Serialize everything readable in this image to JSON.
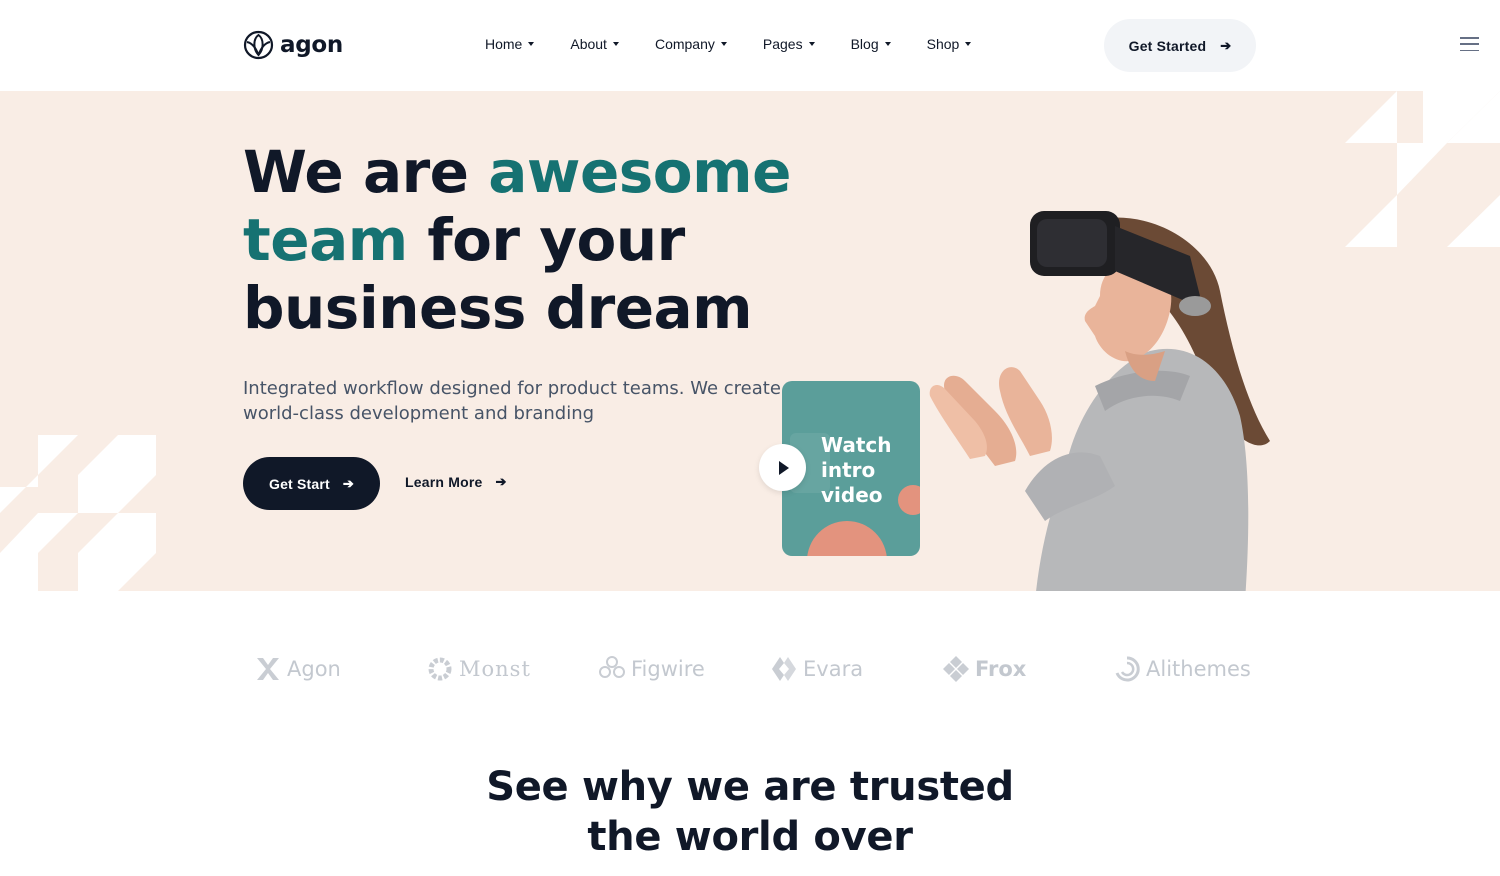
{
  "brand": {
    "name": "agon"
  },
  "nav": {
    "items": [
      {
        "label": "Home"
      },
      {
        "label": "About"
      },
      {
        "label": "Company"
      },
      {
        "label": "Pages"
      },
      {
        "label": "Blog"
      },
      {
        "label": "Shop"
      }
    ]
  },
  "header": {
    "cta_label": "Get Started"
  },
  "hero": {
    "title_part1": "We are ",
    "title_accent1": "awesome",
    "title_accent2": "team",
    "title_part2": " for your",
    "title_part3": "business dream",
    "description": "Integrated workflow designed for product teams. We create world-class development and branding",
    "primary_cta": "Get Start",
    "secondary_cta": "Learn More",
    "video_card_text": "Watch intro video"
  },
  "partners": [
    {
      "name": "Agon",
      "icon": "x-mark-logo-icon"
    },
    {
      "name": "Monst",
      "icon": "gear-logo-icon"
    },
    {
      "name": "Figwire",
      "icon": "flower-logo-icon"
    },
    {
      "name": "Evara",
      "icon": "diamond-logo-icon"
    },
    {
      "name": "Frox",
      "icon": "grid-logo-icon"
    },
    {
      "name": "Alithemes",
      "icon": "swirl-logo-icon"
    }
  ],
  "section": {
    "title_line1": "See why we are trusted",
    "title_line2": "the world over"
  },
  "colors": {
    "accent": "#167272",
    "dark": "#101828",
    "hero_bg": "#f9ede5",
    "video_card": "#5b9e9a",
    "salmon": "#e3937e"
  }
}
